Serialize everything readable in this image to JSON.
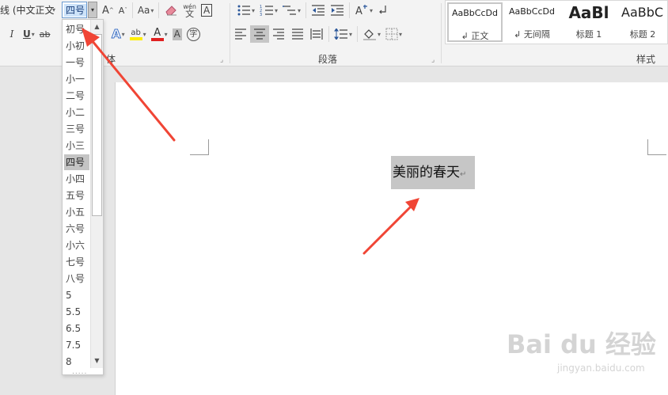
{
  "ribbon": {
    "font": {
      "name": "线 (中文正文",
      "size": "四号"
    },
    "row1": {
      "grow_font": "A",
      "shrink_font": "A",
      "change_case": "Aa",
      "pinyin_top": "wén",
      "pinyin_bottom": "文",
      "char_border": "A"
    },
    "row2": {
      "italic": "I",
      "underline": "U",
      "strikethrough": "ab",
      "text_effects": "A",
      "highlight": "ab",
      "font_color": "A",
      "char_shading": "A",
      "enclose_char": "字"
    },
    "groups": {
      "font_label": "体",
      "paragraph_label": "段落",
      "styles_label": "样式"
    },
    "styles": [
      {
        "preview": "AaBbCcDd",
        "name": "↲ 正文"
      },
      {
        "preview": "AaBbCcDd",
        "name": "↲ 无间隔"
      },
      {
        "preview": "AaBl",
        "name": "标题 1"
      },
      {
        "preview": "AaBbC",
        "name": "标题 2"
      }
    ]
  },
  "font_size_dropdown": {
    "items": [
      "初号",
      "小初",
      "一号",
      "小一",
      "二号",
      "小二",
      "三号",
      "小三",
      "四号",
      "小四",
      "五号",
      "小五",
      "六号",
      "小六",
      "七号",
      "八号",
      "5",
      "5.5",
      "6.5",
      "7.5",
      "8"
    ],
    "selected": "四号",
    "scroll_up": "▲",
    "scroll_down": "▼",
    "grip": "....."
  },
  "document": {
    "text": "美丽的春天",
    "paragraph_mark": "↵"
  },
  "watermark": {
    "logo": "Bai du 经验",
    "url": "jingyan.baidu.com"
  },
  "colors": {
    "highlight_yellow": "#ffee00",
    "font_red": "#e02020",
    "arrow_red": "#f04535",
    "selection_gray": "#c6c6c6"
  }
}
